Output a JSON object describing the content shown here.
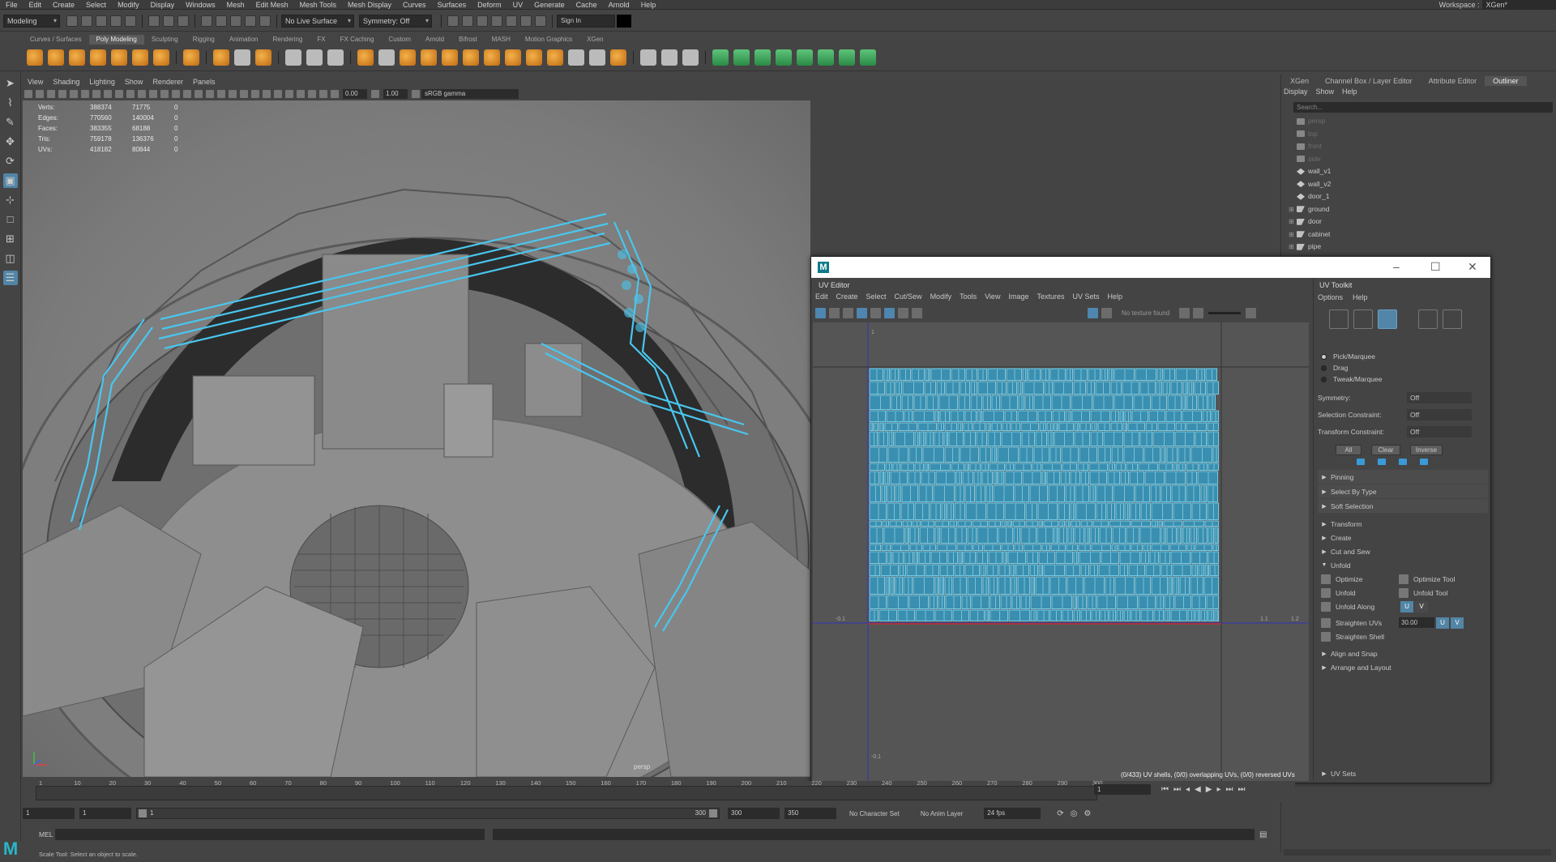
{
  "menubar": {
    "items": [
      "File",
      "Edit",
      "Create",
      "Select",
      "Modify",
      "Display",
      "Windows",
      "Mesh",
      "Edit Mesh",
      "Mesh Tools",
      "Mesh Display",
      "Curves",
      "Surfaces",
      "Deform",
      "UV",
      "Generate",
      "Cache",
      "Arnold",
      "Help"
    ],
    "workspace_label": "Workspace :",
    "workspace_value": "XGen*"
  },
  "statusline": {
    "mode": "Modeling",
    "live_surface": "No Live Surface",
    "symmetry": "Symmetry: Off",
    "sign_in": "Sign In"
  },
  "shelf": {
    "tabs": [
      "Curves / Surfaces",
      "Poly Modeling",
      "Sculpting",
      "Rigging",
      "Animation",
      "Rendering",
      "FX",
      "FX Caching",
      "Custom",
      "Arnold",
      "Bifrost",
      "MASH",
      "Motion Graphics",
      "XGen"
    ],
    "active_tab": "Poly Modeling"
  },
  "viewport": {
    "menu": [
      "View",
      "Shading",
      "Lighting",
      "Show",
      "Renderer",
      "Panels"
    ],
    "exposure": "0.00",
    "gamma": "1.00",
    "color_space": "sRGB gamma",
    "camera_label": "persp",
    "hud": [
      {
        "label": "Verts:",
        "v1": "388374",
        "v2": "71775",
        "v3": "0"
      },
      {
        "label": "Edges:",
        "v1": "770560",
        "v2": "140004",
        "v3": "0"
      },
      {
        "label": "Faces:",
        "v1": "383355",
        "v2": "68188",
        "v3": "0"
      },
      {
        "label": "Tris:",
        "v1": "759178",
        "v2": "136376",
        "v3": "0"
      },
      {
        "label": "UVs:",
        "v1": "418182",
        "v2": "80844",
        "v3": "0"
      }
    ]
  },
  "outliner": {
    "tabs": [
      "XGen",
      "Channel Box / Layer Editor",
      "Attribute Editor",
      "Outliner"
    ],
    "active_tab": "Outliner",
    "menu": [
      "Display",
      "Show",
      "Help"
    ],
    "search_placeholder": "Search...",
    "items": [
      {
        "name": "persp",
        "type": "cam",
        "dim": true,
        "expandable": false
      },
      {
        "name": "top",
        "type": "cam",
        "dim": true,
        "expandable": false
      },
      {
        "name": "front",
        "type": "cam",
        "dim": true,
        "expandable": false
      },
      {
        "name": "side",
        "type": "cam",
        "dim": true,
        "expandable": false
      },
      {
        "name": "wall_v1",
        "type": "mesh",
        "dim": false,
        "expandable": false
      },
      {
        "name": "wall_v2",
        "type": "mesh",
        "dim": false,
        "expandable": false
      },
      {
        "name": "door_1",
        "type": "mesh",
        "dim": false,
        "expandable": false
      },
      {
        "name": "ground",
        "type": "grp",
        "dim": false,
        "expandable": true
      },
      {
        "name": "door",
        "type": "grp",
        "dim": false,
        "expandable": true
      },
      {
        "name": "cabinet",
        "type": "grp",
        "dim": false,
        "expandable": true
      },
      {
        "name": "pipe",
        "type": "grp",
        "dim": false,
        "expandable": true
      }
    ]
  },
  "uv_editor": {
    "panel_title": "UV Editor",
    "menu": [
      "Edit",
      "Create",
      "Select",
      "Cut/Sew",
      "Modify",
      "Tools",
      "View",
      "Image",
      "Textures",
      "UV Sets",
      "Help"
    ],
    "no_texture": "No texture found",
    "axis_labels": {
      "neg_x": "-0.1",
      "x11": "1.1",
      "x12": "1.2",
      "y_top": "1",
      "y_neg": "-0.1"
    },
    "info": "(0/433) UV shells, (0/0) overlapping UVs, (0/0) reversed UVs"
  },
  "uv_toolkit": {
    "title": "UV Toolkit",
    "menu": [
      "Options",
      "Help"
    ],
    "pick_modes": [
      "Pick/Marquee",
      "Drag",
      "Tweak/Marquee"
    ],
    "symmetry_label": "Symmetry:",
    "symmetry_value": "Off",
    "selection_constraint_label": "Selection Constraint:",
    "selection_constraint_value": "Off",
    "transform_constraint_label": "Transform Constraint:",
    "transform_constraint_value": "Off",
    "buttons": {
      "all": "All",
      "clear": "Clear",
      "inverse": "Inverse"
    },
    "subsections": [
      "Pinning",
      "Select By Type",
      "Soft Selection"
    ],
    "sections": [
      "Transform",
      "Create",
      "Cut and Sew"
    ],
    "unfold_section": "Unfold",
    "unfold": {
      "optimize": "Optimize",
      "optimize_tool": "Optimize Tool",
      "unfold": "Unfold",
      "unfold_tool": "Unfold Tool",
      "unfold_along": "Unfold Along",
      "u": "U",
      "v": "V",
      "straighten_uvs": "Straighten UVs",
      "straighten_value": "30.00",
      "straighten_shell": "Straighten Shell"
    },
    "after_sections": [
      "Align and Snap",
      "Arrange and Layout"
    ],
    "uv_sets": "UV Sets"
  },
  "timeline": {
    "ticks": [
      "1",
      "10",
      "20",
      "30",
      "40",
      "50",
      "60",
      "70",
      "80",
      "90",
      "100",
      "110",
      "120",
      "130",
      "140",
      "150",
      "160",
      "170",
      "180",
      "190",
      "200",
      "210",
      "220",
      "230",
      "240",
      "250",
      "260",
      "270",
      "280",
      "290",
      "300"
    ],
    "current_frame": "1",
    "range_start": "1",
    "range_start2": "1",
    "slider_start": "1",
    "slider_end": "300",
    "anim_end": "300",
    "anim_end2": "350",
    "character_set": "No Character Set",
    "anim_layer": "No Anim Layer",
    "fps": "24 fps"
  },
  "commandline": {
    "label": "MEL",
    "help": "Scale Tool: Select an object to scale."
  }
}
